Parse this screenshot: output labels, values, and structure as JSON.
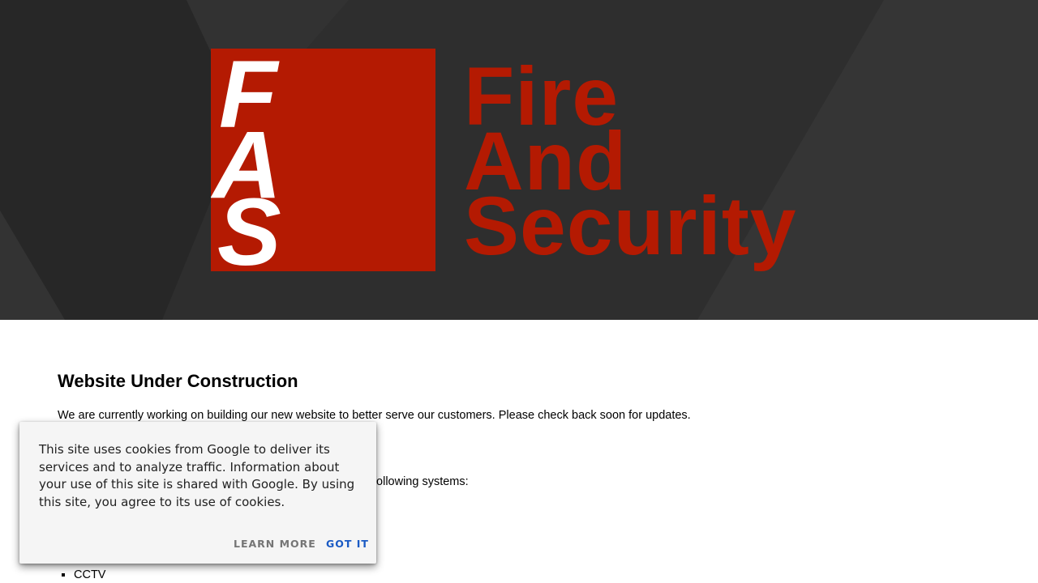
{
  "hero": {
    "logo_letters": [
      "F",
      "A",
      "S"
    ],
    "brand_lines": [
      "Fire",
      "And",
      "Security"
    ],
    "colors": {
      "brand_red": "#b41a02",
      "background": "#2e2e2e"
    }
  },
  "main": {
    "title": "Website Under Construction",
    "intro": "We are currently working on building our new website to better serve our customers. Please check back soon for updates.",
    "systems_intro_partial": "following systems:",
    "systems": [
      "CCTV"
    ]
  },
  "cookie_banner": {
    "message": "This site uses cookies from Google to deliver its services and to analyze traffic. Information about your use of this site is shared with Google. By using this site, you agree to its use of cookies.",
    "learn_more_label": "LEARN MORE",
    "got_it_label": "GOT IT"
  }
}
